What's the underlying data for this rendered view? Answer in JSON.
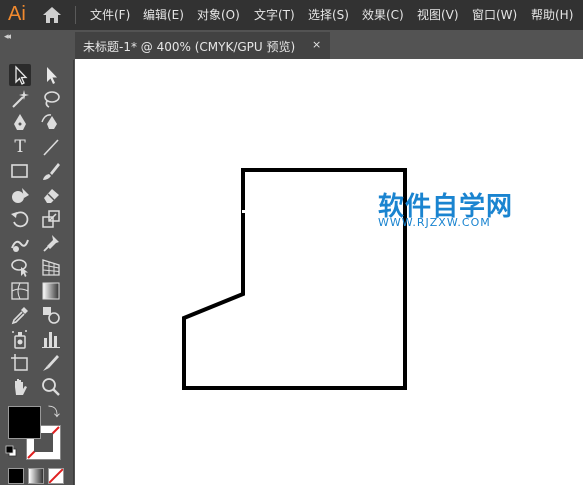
{
  "app": {
    "logo": "Ai",
    "accent_color": "#f28a2e"
  },
  "menu": [
    "文件(F)",
    "编辑(E)",
    "对象(O)",
    "文字(T)",
    "选择(S)",
    "效果(C)",
    "视图(V)",
    "窗口(W)",
    "帮助(H)"
  ],
  "tab": {
    "title": "未标题-1* @ 400% (CMYK/GPU 预览)",
    "close": "×"
  },
  "panel": {
    "collapse": "◂◂"
  },
  "tools": {
    "type_glyph": "T",
    "icons": [
      "selection-tool-icon",
      "direct-selection-tool-icon",
      "magic-wand-tool-icon",
      "lasso-tool-icon",
      "pen-tool-icon",
      "curvature-tool-icon",
      "type-tool-icon",
      "line-segment-tool-icon",
      "rectangle-tool-icon",
      "paintbrush-tool-icon",
      "shaper-tool-icon",
      "eraser-tool-icon",
      "rotate-tool-icon",
      "scale-tool-icon",
      "warp-tool-icon",
      "free-transform-tool-icon",
      "shape-builder-tool-icon",
      "perspective-grid-tool-icon",
      "mesh-tool-icon",
      "gradient-tool-icon",
      "eyedropper-tool-icon",
      "blend-tool-icon",
      "symbol-sprayer-tool-icon",
      "column-graph-tool-icon",
      "artboard-tool-icon",
      "slice-tool-icon",
      "hand-tool-icon",
      "zoom-tool-icon"
    ]
  },
  "colors": {
    "fill": "#000000",
    "stroke": "none"
  },
  "watermark": {
    "cn": "软件自学网",
    "en": "WWW.RJZXW.COM",
    "color": "#1a84d0"
  }
}
